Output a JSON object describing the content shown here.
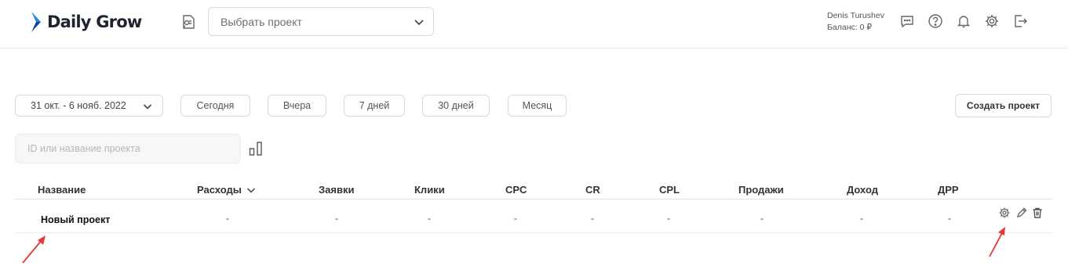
{
  "header": {
    "brand": "Daily Grow",
    "project_select": {
      "placeholder": "Выбрать проект"
    },
    "user": {
      "name": "Denis Turushev",
      "balance": "Баланс: 0 ₽"
    },
    "icons": [
      "message-icon",
      "help-icon",
      "bell-icon",
      "gear-icon",
      "logout-icon"
    ]
  },
  "toolbar": {
    "date_range": "31 окт. - 6 нояб. 2022",
    "quick_ranges": [
      "Сегодня",
      "Вчера",
      "7 дней",
      "30 дней",
      "Месяц"
    ],
    "create_project": "Создать проект"
  },
  "search": {
    "placeholder": "ID или название проекта"
  },
  "table": {
    "columns": [
      "Название",
      "Расходы",
      "Заявки",
      "Клики",
      "CPC",
      "CR",
      "CPL",
      "Продажи",
      "Доход",
      "ДРР"
    ],
    "rows": [
      {
        "name": "Новый проект",
        "values": [
          "-",
          "-",
          "-",
          "-",
          "-",
          "-",
          "-",
          "-",
          "-"
        ]
      }
    ]
  },
  "colors": {
    "brand_blue": "#1e88e5",
    "brand_dark": "#0d47a1",
    "annotation_red": "#e53935",
    "border": "#d9d9d9"
  }
}
